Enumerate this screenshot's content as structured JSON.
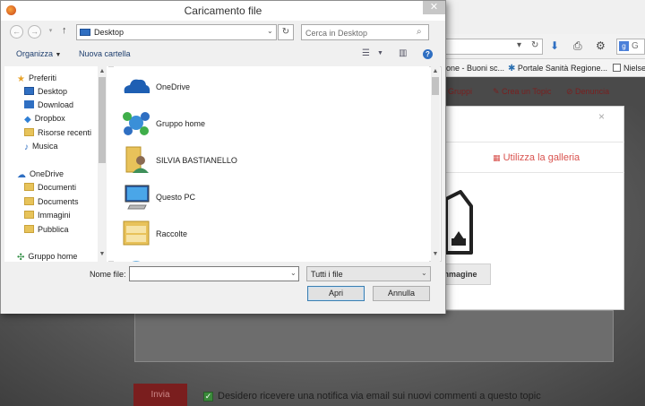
{
  "browser": {
    "bookmarks": [
      {
        "label": "one - Buoni sc..."
      },
      {
        "label": "Portale Sanità Regione..."
      },
      {
        "label": "Nielse"
      }
    ],
    "search_placeholder": "G",
    "site_links": [
      {
        "label": "Gruppi"
      },
      {
        "label": "Crea un Topic"
      },
      {
        "label": "Denuncia"
      }
    ],
    "modal": {
      "close_glyph": "×",
      "gallery_label": "Utilizza la galleria",
      "image_button_label": "mmagine"
    },
    "invia_label": "Invia",
    "notify_label": "Desidero ricevere una notifica via email sui nuovi commenti a questo topic"
  },
  "dialog": {
    "title": "Caricamento file",
    "close_glyph": "✕",
    "address": "Desktop",
    "search_placeholder": "Cerca in Desktop",
    "toolbar": {
      "organize_label": "Organizza",
      "new_folder_label": "Nuova cartella"
    },
    "nav_tree": [
      {
        "label": "Preferiti",
        "icon": "star-icon"
      },
      {
        "label": "Desktop",
        "icon": "desktop-icon"
      },
      {
        "label": "Download",
        "icon": "download-icon"
      },
      {
        "label": "Dropbox",
        "icon": "dropbox-icon"
      },
      {
        "label": "Risorse recenti",
        "icon": "recent-icon"
      },
      {
        "label": "Musica",
        "icon": "music-icon"
      },
      {
        "label": "OneDrive",
        "icon": "cloud-icon"
      },
      {
        "label": "Documenti",
        "icon": "folder-icon"
      },
      {
        "label": "Documents",
        "icon": "folder-icon"
      },
      {
        "label": "Immagini",
        "icon": "folder-icon"
      },
      {
        "label": "Pubblica",
        "icon": "folder-icon"
      },
      {
        "label": "Gruppo home",
        "icon": "homegroup-icon"
      }
    ],
    "files": [
      {
        "name": "OneDrive",
        "icon": "onedrive-icon"
      },
      {
        "name": "Gruppo home",
        "icon": "homegroup-icon"
      },
      {
        "name": "SILVIA BASTIANELLO",
        "icon": "user-folder-icon"
      },
      {
        "name": "Questo PC",
        "icon": "computer-icon"
      },
      {
        "name": "Raccolte",
        "icon": "libraries-icon"
      }
    ],
    "file_name_label": "Nome file:",
    "file_name_value": "",
    "file_type": "Tutti i file",
    "open_label": "Apri",
    "cancel_label": "Annulla"
  }
}
